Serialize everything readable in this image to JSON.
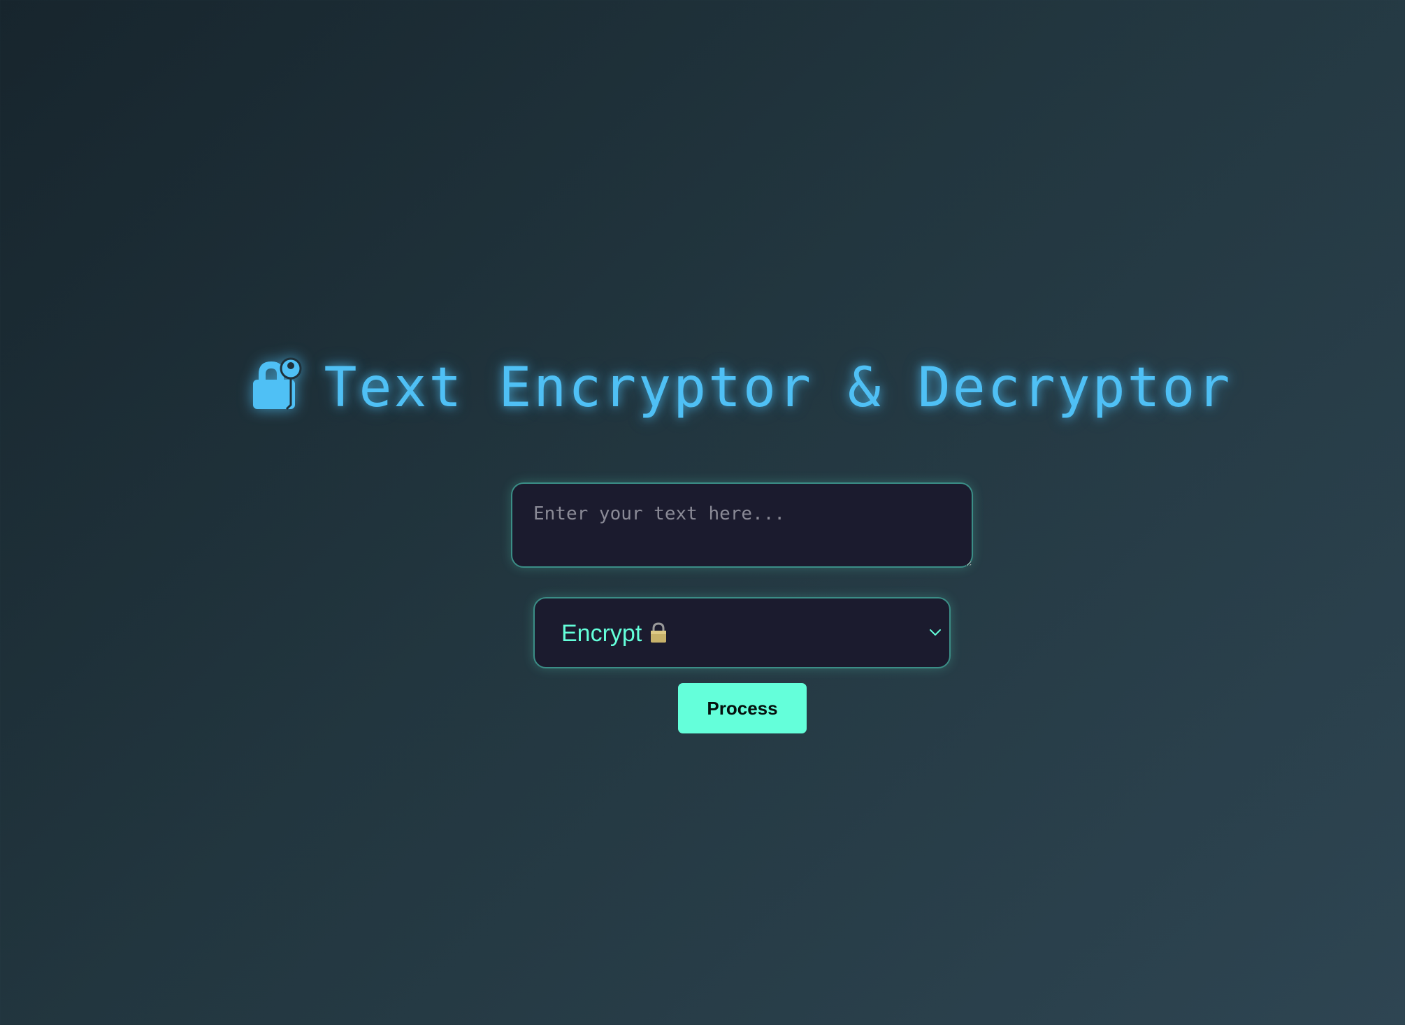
{
  "header": {
    "title": "Text Encryptor & Decryptor",
    "title_icon": "lock-icon"
  },
  "input": {
    "placeholder": "Enter your text here...",
    "value": ""
  },
  "mode_select": {
    "selected_label": "Encrypt",
    "selected_icon": "lock-icon"
  },
  "actions": {
    "process_label": "Process"
  },
  "colors": {
    "accent": "#64ffda",
    "title": "#4fc0f5",
    "field_background": "#1b1b2e",
    "field_border": "#3b8d86",
    "background_start": "#17252d",
    "background_end": "#2e4552"
  }
}
